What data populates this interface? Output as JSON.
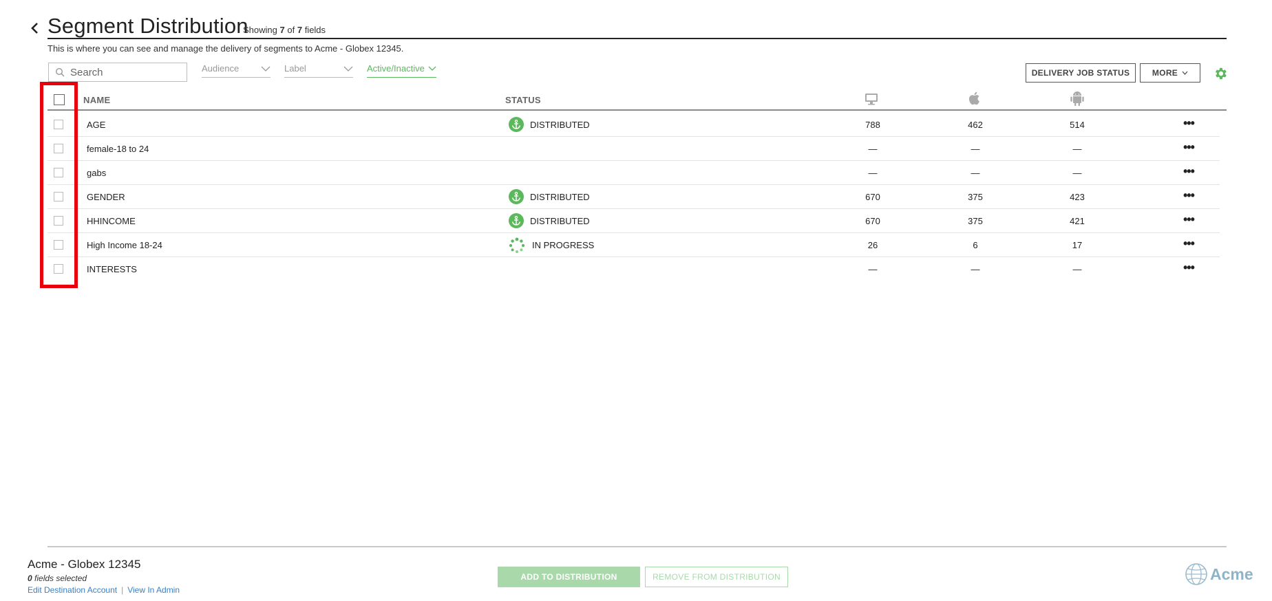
{
  "header": {
    "title": "Segment Distribution",
    "showing_prefix": "Showing",
    "showing_count": "7",
    "showing_of": "of",
    "showing_total": "7",
    "showing_suffix": "fields",
    "subtitle": "This is where you can see and manage the delivery of segments to Acme - Globex 12345."
  },
  "toolbar": {
    "search_placeholder": "Search",
    "filters": [
      {
        "label": "Audience",
        "active": false
      },
      {
        "label": "Label",
        "active": false
      },
      {
        "label": "Active/Inactive",
        "active": true
      }
    ],
    "delivery_job_status": "DELIVERY JOB STATUS",
    "more": "MORE"
  },
  "table": {
    "columns": {
      "name": "NAME",
      "status": "STATUS",
      "desktop_icon": "desktop-icon",
      "apple_icon": "apple-icon",
      "android_icon": "android-icon"
    },
    "rows": [
      {
        "name": "AGE",
        "status": "DISTRIBUTED",
        "status_icon": "anchor-icon",
        "desktop": "788",
        "ios": "462",
        "android": "514"
      },
      {
        "name": "female-18 to 24",
        "status": "",
        "status_icon": "",
        "desktop": "—",
        "ios": "—",
        "android": "—"
      },
      {
        "name": "gabs",
        "status": "",
        "status_icon": "",
        "desktop": "—",
        "ios": "—",
        "android": "—"
      },
      {
        "name": "GENDER",
        "status": "DISTRIBUTED",
        "status_icon": "anchor-icon",
        "desktop": "670",
        "ios": "375",
        "android": "423"
      },
      {
        "name": "HHINCOME",
        "status": "DISTRIBUTED",
        "status_icon": "anchor-icon",
        "desktop": "670",
        "ios": "375",
        "android": "421"
      },
      {
        "name": "High Income 18-24",
        "status": "IN PROGRESS",
        "status_icon": "spinner-icon",
        "desktop": "26",
        "ios": "6",
        "android": "17"
      },
      {
        "name": "INTERESTS",
        "status": "",
        "status_icon": "",
        "desktop": "—",
        "ios": "—",
        "android": "—"
      }
    ],
    "row_menu": "•••"
  },
  "footer": {
    "account_name": "Acme - Globex 12345",
    "fields_selected_count": "0",
    "fields_selected_label": "fields selected",
    "edit_link": "Edit Destination Account",
    "admin_link": "View In Admin",
    "add_button": "ADD TO DISTRIBUTION",
    "remove_button": "REMOVE FROM DISTRIBUTION",
    "brand": "Acme"
  },
  "colors": {
    "accent_green": "#5cb85c",
    "highlight_red": "#e8000b",
    "link_blue": "#3a7fc1"
  }
}
